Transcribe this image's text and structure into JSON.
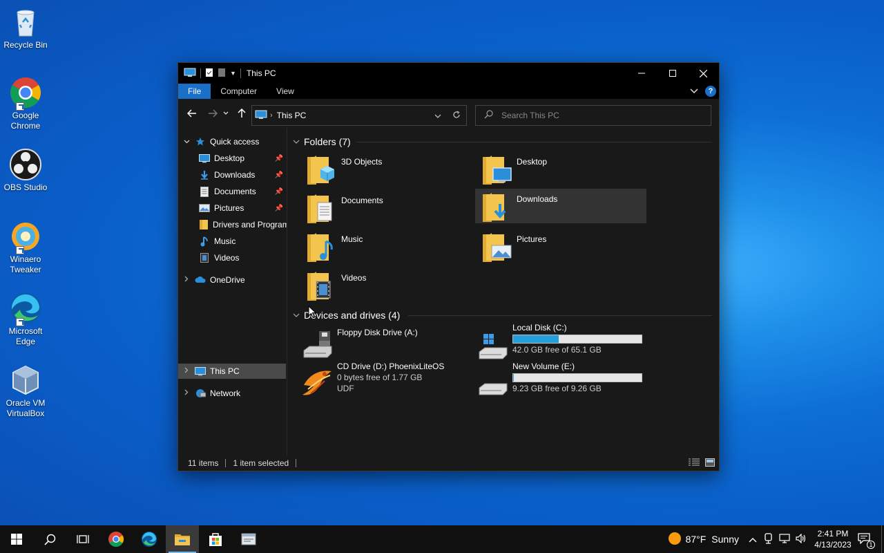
{
  "desktop": {
    "icons": [
      {
        "label": "Recycle Bin"
      },
      {
        "label": "Google Chrome"
      },
      {
        "label": "OBS Studio"
      },
      {
        "label": "Winaero Tweaker"
      },
      {
        "label": "Microsoft Edge"
      },
      {
        "label": "Oracle VM VirtualBox"
      }
    ]
  },
  "window": {
    "title": "This PC",
    "ribbon_tabs": [
      "File",
      "Computer",
      "View"
    ],
    "address": {
      "path_item": "This PC"
    },
    "search": {
      "placeholder": "Search This PC"
    },
    "sidebar": {
      "quick_access": "Quick access",
      "items": [
        {
          "label": "Desktop"
        },
        {
          "label": "Downloads"
        },
        {
          "label": "Documents"
        },
        {
          "label": "Pictures"
        },
        {
          "label": "Drivers and Program"
        },
        {
          "label": "Music"
        },
        {
          "label": "Videos"
        }
      ],
      "onedrive": "OneDrive",
      "this_pc": "This PC",
      "network": "Network"
    },
    "folders_group": "Folders (7)",
    "folders": [
      {
        "name": "3D Objects"
      },
      {
        "name": "Desktop"
      },
      {
        "name": "Documents"
      },
      {
        "name": "Downloads"
      },
      {
        "name": "Music"
      },
      {
        "name": "Pictures"
      },
      {
        "name": "Videos"
      }
    ],
    "drives_group": "Devices and drives (4)",
    "drives": [
      {
        "name": "Floppy Disk Drive (A:)"
      },
      {
        "name": "Local Disk (C:)",
        "free": "42.0 GB free of 65.1 GB",
        "used_fraction": 0.355
      },
      {
        "name": "CD Drive (D:) PhoenixLiteOS",
        "free": "0 bytes free of 1.77 GB",
        "fs": "UDF"
      },
      {
        "name": "New Volume (E:)",
        "free": "9.23 GB free of 9.26 GB",
        "used_fraction": 0.003
      }
    ],
    "status": {
      "items": "11 items",
      "selected": "1 item selected"
    }
  },
  "taskbar": {
    "weather": {
      "temp": "87°F",
      "condition": "Sunny"
    },
    "time": "2:41 PM",
    "date": "4/13/2023",
    "notifications": "1"
  },
  "colors": {
    "accent": "#1a6fc9",
    "drive_bar": "#26a0da",
    "folder": "#f3c54f"
  }
}
